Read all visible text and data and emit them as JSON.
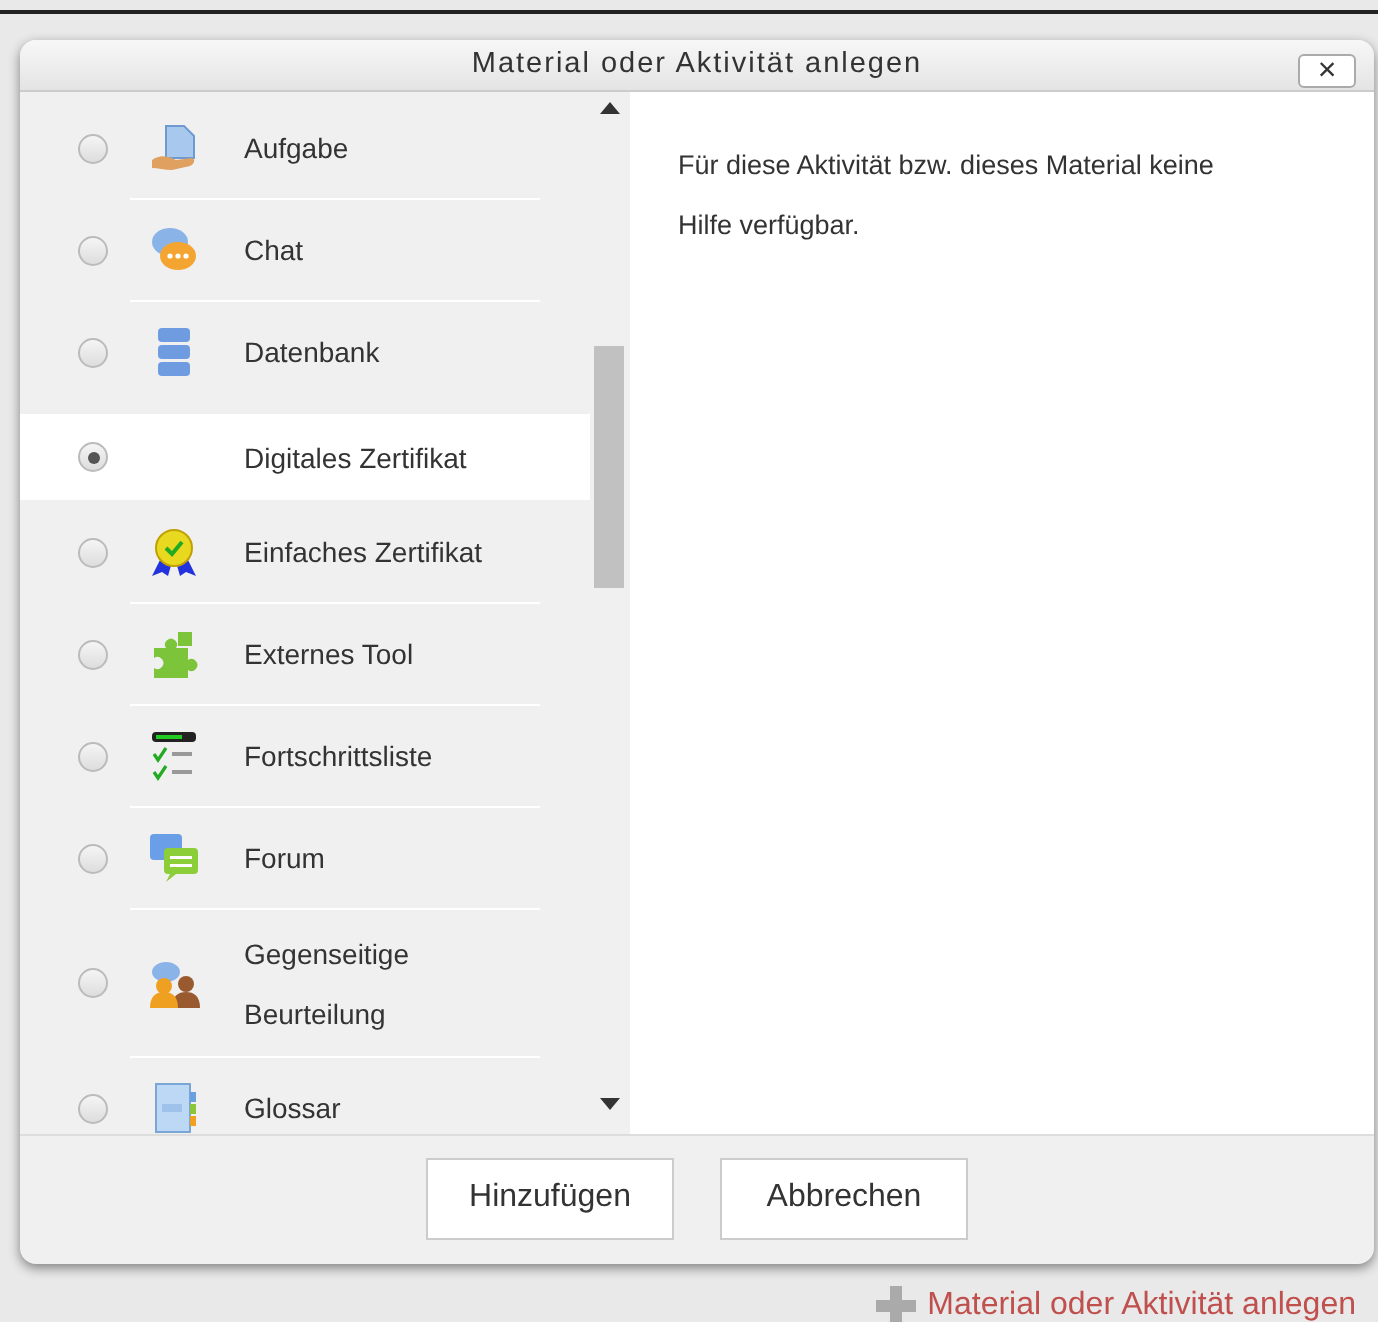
{
  "dialog": {
    "title": "Material oder Aktivität anlegen",
    "close": "×"
  },
  "items": [
    {
      "label": "Aufgabe",
      "kind": "assignment",
      "selected": false
    },
    {
      "label": "Chat",
      "kind": "chat",
      "selected": false
    },
    {
      "label": "Datenbank",
      "kind": "database",
      "selected": false
    },
    {
      "label": "Digitales Zertifikat",
      "kind": "none",
      "selected": true
    },
    {
      "label": "Einfaches Zertifikat",
      "kind": "award",
      "selected": false
    },
    {
      "label": "Externes Tool",
      "kind": "puzzle",
      "selected": false
    },
    {
      "label": "Fortschrittsliste",
      "kind": "checklist",
      "selected": false
    },
    {
      "label": "Forum",
      "kind": "forum",
      "selected": false
    },
    {
      "label": "Gegenseitige Beurteilung",
      "kind": "people",
      "selected": false
    },
    {
      "label": "Glossar",
      "kind": "glossary",
      "selected": false
    }
  ],
  "help_text": "Für diese Aktivität bzw. dieses Material keine Hilfe verfügbar.",
  "buttons": [
    "Hinzufügen",
    "Abbrechen"
  ],
  "add_link": "Material oder Aktivität anlegen"
}
